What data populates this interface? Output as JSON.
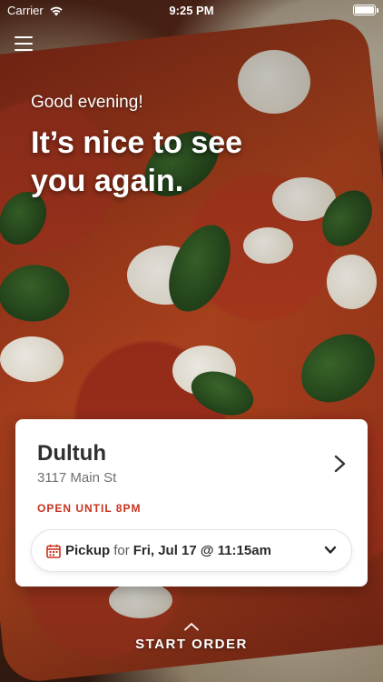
{
  "status_bar": {
    "carrier": "Carrier",
    "time": "9:25 PM"
  },
  "hero": {
    "greeting": "Good evening!",
    "headline": "It’s nice to see you again."
  },
  "location_card": {
    "store_name": "Dultuh",
    "address": "3117 Main St",
    "hours_status": "OPEN UNTIL 8PM",
    "order": {
      "mode": "Pickup",
      "connector": "for",
      "datetime": "Fri, Jul 17 @ 11:15am"
    }
  },
  "start_order": {
    "label": "START ORDER"
  },
  "colors": {
    "accent_red": "#c8321e",
    "card_bg": "#ffffff",
    "text_dark": "#2f2f2f",
    "text_muted": "#707070"
  },
  "icons": [
    "wifi-icon",
    "battery-icon",
    "menu-icon",
    "chevron-right-icon",
    "calendar-icon",
    "chevron-down-icon",
    "chevron-up-icon"
  ]
}
